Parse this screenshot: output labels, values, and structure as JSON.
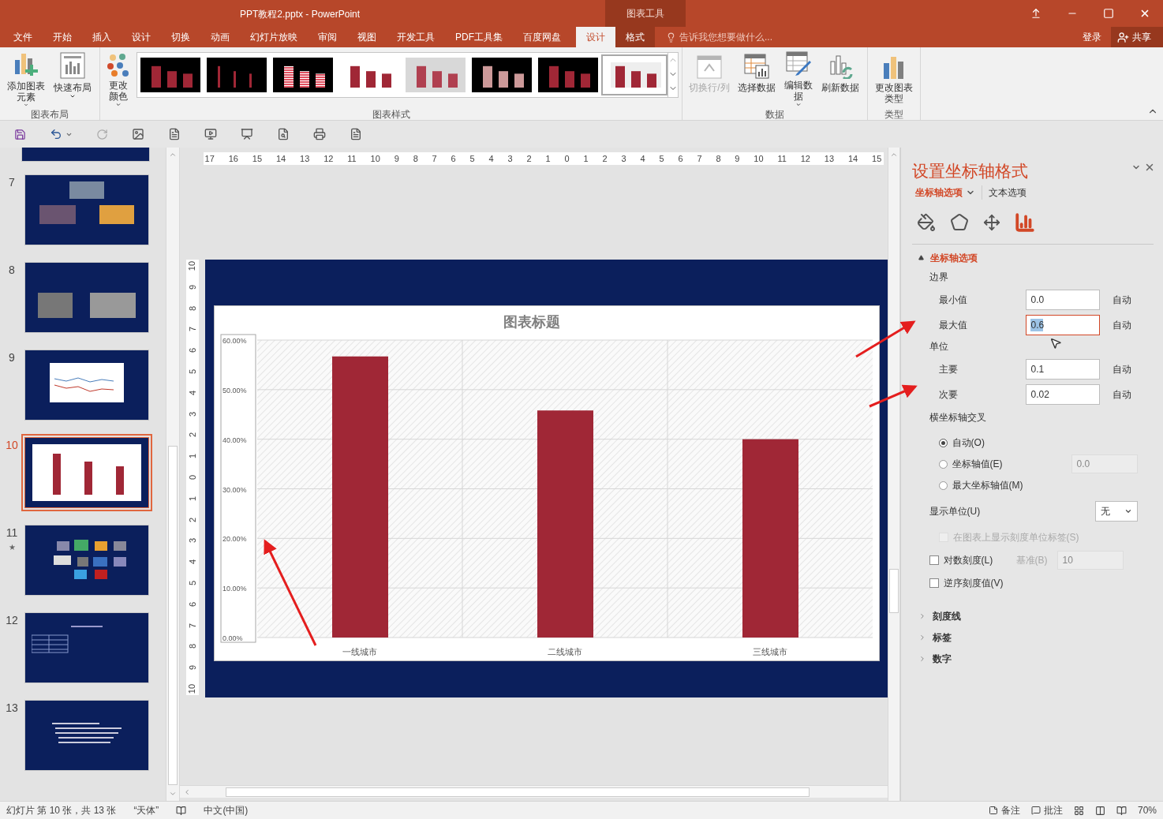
{
  "window": {
    "title": "PPT教程2.pptx - PowerPoint",
    "context_label": "图表工具"
  },
  "tabs": [
    {
      "label": "文件",
      "selected": false,
      "contextual": false
    },
    {
      "label": "开始",
      "selected": false,
      "contextual": false
    },
    {
      "label": "插入",
      "selected": false,
      "contextual": false
    },
    {
      "label": "设计",
      "selected": false,
      "contextual": false
    },
    {
      "label": "切换",
      "selected": false,
      "contextual": false
    },
    {
      "label": "动画",
      "selected": false,
      "contextual": false
    },
    {
      "label": "幻灯片放映",
      "selected": false,
      "contextual": false
    },
    {
      "label": "审阅",
      "selected": false,
      "contextual": false
    },
    {
      "label": "视图",
      "selected": false,
      "contextual": false
    },
    {
      "label": "开发工具",
      "selected": false,
      "contextual": false
    },
    {
      "label": "PDF工具集",
      "selected": false,
      "contextual": false
    },
    {
      "label": "百度网盘",
      "selected": false,
      "contextual": false
    },
    {
      "label": "设计",
      "selected": true,
      "contextual": true
    },
    {
      "label": "格式",
      "selected": false,
      "contextual": true
    }
  ],
  "tell_me": {
    "placeholder": "告诉我您想要做什么..."
  },
  "account": {
    "sign_in": "登录",
    "share": "共享"
  },
  "ribbon": {
    "groups": [
      {
        "label": "图表布局",
        "buttons": [
          {
            "label": "添加图表元素",
            "dropdown": true,
            "disabled": false
          },
          {
            "label": "快速布局",
            "dropdown": true,
            "disabled": false
          }
        ]
      },
      {
        "label": "图表样式",
        "buttons": [
          {
            "label": "更改颜色",
            "dropdown": true,
            "disabled": false
          }
        ],
        "gallery": [
          {
            "selected": false
          },
          {
            "selected": false
          },
          {
            "selected": false
          },
          {
            "selected": false
          },
          {
            "selected": false
          },
          {
            "selected": false
          },
          {
            "selected": false
          },
          {
            "selected": true
          }
        ]
      },
      {
        "label": "数据",
        "buttons": [
          {
            "label": "切换行/列",
            "dropdown": false,
            "disabled": true
          },
          {
            "label": "选择数据",
            "dropdown": false,
            "disabled": false
          },
          {
            "label": "编辑数据",
            "dropdown": true,
            "disabled": false
          },
          {
            "label": "刷新数据",
            "dropdown": false,
            "disabled": false
          }
        ]
      },
      {
        "label": "类型",
        "buttons": [
          {
            "label": "更改图表类型",
            "dropdown": false,
            "disabled": false
          }
        ]
      }
    ]
  },
  "slides": [
    {
      "number": "7",
      "selected": false,
      "kind": "photos"
    },
    {
      "number": "8",
      "selected": false,
      "kind": "photos2"
    },
    {
      "number": "9",
      "selected": false,
      "kind": "line"
    },
    {
      "number": "10",
      "selected": true,
      "kind": "bars"
    },
    {
      "number": "11",
      "selected": false,
      "marker": "★",
      "kind": "grid"
    },
    {
      "number": "12",
      "selected": false,
      "kind": "table"
    },
    {
      "number": "13",
      "selected": false,
      "kind": "text"
    }
  ],
  "horizontal_ruler": [
    "17",
    "16",
    "15",
    "14",
    "13",
    "12",
    "11",
    "10",
    "9",
    "8",
    "7",
    "6",
    "5",
    "4",
    "3",
    "2",
    "1",
    "0",
    "1",
    "2",
    "3",
    "4",
    "5",
    "6",
    "7",
    "8",
    "9",
    "10",
    "11",
    "12",
    "13",
    "14",
    "15"
  ],
  "vertical_ruler": [
    "10",
    "9",
    "8",
    "7",
    "6",
    "5",
    "4",
    "3",
    "2",
    "1",
    "0",
    "1",
    "2",
    "3",
    "4",
    "5",
    "6",
    "7",
    "8",
    "9",
    "10"
  ],
  "chart": {
    "chart_data": {
      "type": "bar",
      "title": "图表标题",
      "categories": [
        "一线城市",
        "二线城市",
        "三线城市"
      ],
      "grid": true,
      "series": [
        {
          "color": "#a02736",
          "values": [
            0.567,
            0.458,
            0.4
          ]
        }
      ],
      "ylim": [
        0,
        0.6
      ],
      "yticks": [
        {
          "value": 0,
          "label": "0.00%"
        },
        {
          "value": 0.1,
          "label": "10.00%"
        },
        {
          "value": 0.2,
          "label": "20.00%"
        },
        {
          "value": 0.3,
          "label": "30.00%"
        },
        {
          "value": 0.4,
          "label": "40.00%"
        },
        {
          "value": 0.5,
          "label": "50.00%"
        },
        {
          "value": 0.6,
          "label": "60.00%"
        }
      ]
    }
  },
  "pane": {
    "title": "设置坐标轴格式",
    "tabs": [
      {
        "label": "坐标轴选项",
        "selected": true
      },
      {
        "label": "文本选项",
        "selected": false
      }
    ],
    "section": "坐标轴选项",
    "bounds_label": "边界",
    "bounds": [
      {
        "label": "最小值",
        "value": "0.0",
        "focused": false,
        "auto": "自动"
      },
      {
        "label": "最大值",
        "value": "0.6",
        "focused": true,
        "auto": "自动"
      }
    ],
    "units_label": "单位",
    "units": [
      {
        "label": "主要",
        "value": "0.1",
        "focused": false,
        "auto": "自动"
      },
      {
        "label": "次要",
        "value": "0.02",
        "focused": false,
        "auto": "自动"
      }
    ],
    "cross_label": "横坐标轴交叉",
    "cross": [
      {
        "label": "自动(O)",
        "selected": true
      },
      {
        "label": "坐标轴值(E)",
        "selected": false,
        "value": "0.0"
      },
      {
        "label": "最大坐标轴值(M)",
        "selected": false
      }
    ],
    "display_units": {
      "label": "显示单位(U)",
      "value": "无"
    },
    "checks": [
      {
        "label": "在图表上显示刻度单位标签(S)",
        "checked": false,
        "disabled": true
      },
      {
        "label": "对数刻度(L)",
        "checked": false,
        "disabled": false,
        "base_label": "基准(B)",
        "base_value": "10"
      },
      {
        "label": "逆序刻度值(V)",
        "checked": false,
        "disabled": false
      }
    ],
    "collapsed": [
      "刻度线",
      "标签",
      "数字"
    ]
  },
  "status_bar": {
    "slide": "幻灯片 第 10 张，共 13 张",
    "theme": "“天体”",
    "language": "中文(中国)",
    "notes": "备注",
    "comments": "批注",
    "zoom": "70%"
  }
}
